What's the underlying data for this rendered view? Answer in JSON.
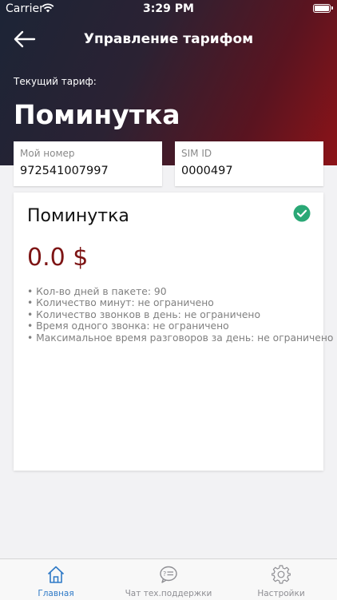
{
  "status_bar": {
    "carrier": "Carrier",
    "time": "3:29 PM"
  },
  "nav": {
    "title": "Управление тарифом"
  },
  "current_tariff": {
    "label": "Текущий тариф:",
    "name": "Поминутка"
  },
  "fields": {
    "my_number": {
      "label": "Мой номер",
      "value": "972541007997"
    },
    "sim_id": {
      "label": "SIM ID",
      "value": "0000497"
    }
  },
  "plan": {
    "name": "Поминутка",
    "price": "0.0 $",
    "features": [
      "• Кол-во дней в пакете: 90",
      "• Количество минут: не ограничено",
      "• Количество звонков в день: не ограничено",
      "• Время одного звонка: не ограничено",
      "• Максимальное время разговоров за день: не ограничено"
    ]
  },
  "tabs": [
    {
      "label": "Главная",
      "icon": "home-icon",
      "active": true
    },
    {
      "label": "Чат тех.поддержки",
      "icon": "chat-icon",
      "active": false
    },
    {
      "label": "Настройки",
      "icon": "gear-icon",
      "active": false
    }
  ],
  "colors": {
    "accent": "#2f7ac7",
    "price": "#7d1414",
    "check": "#2aa876"
  }
}
